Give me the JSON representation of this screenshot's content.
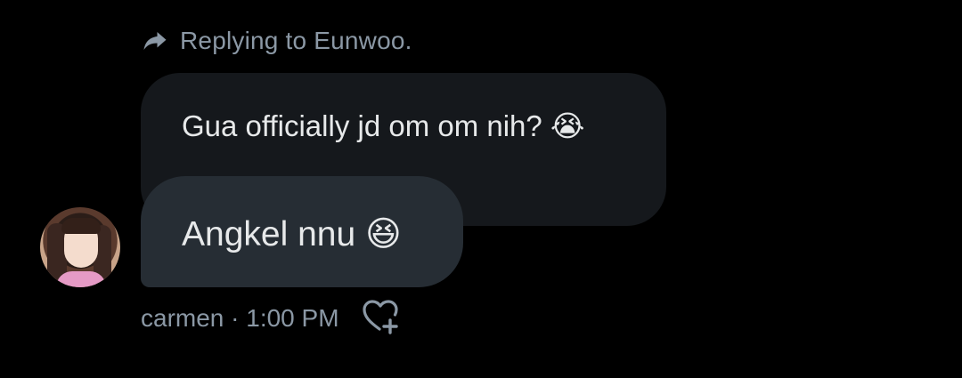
{
  "reply": {
    "icon": "reply-arrow-icon",
    "text": "Replying to Eunwoo."
  },
  "quoted_message": {
    "text": "Gua officially jd om om nih? ",
    "emoji": "😭"
  },
  "message": {
    "text": "Angkel nnu ",
    "emoji": "😆",
    "avatar_icon": "avatar"
  },
  "meta": {
    "sender_time": "carmen · 1:00 PM",
    "react_icon": "heart-plus-icon"
  },
  "colors": {
    "background": "#000000",
    "quoted_bubble": "#15181c",
    "message_bubble": "#262d34",
    "primary_text": "#e7e9ea",
    "secondary_text": "#8b98a5"
  }
}
